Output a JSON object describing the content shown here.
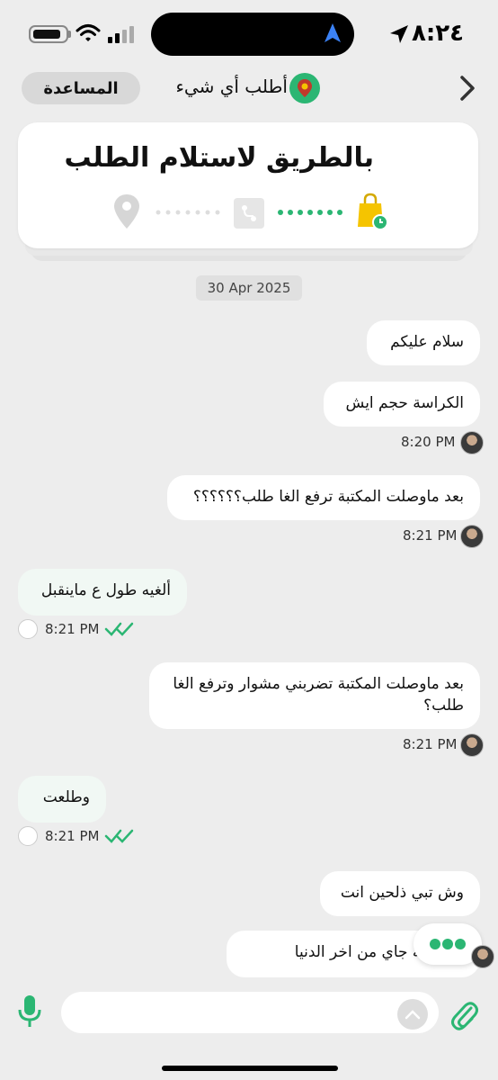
{
  "status_bar": {
    "time": "٨:٢٤"
  },
  "header": {
    "help_label": "المساعدة",
    "title": "أطلب أي شيء"
  },
  "order_card": {
    "title": "بالطريق لاستلام الطلب"
  },
  "date_chip": "30 Apr 2025",
  "messages": [
    {
      "text": "سلام عليكم"
    },
    {
      "text": "الكراسة حجم ايش",
      "time": "8:20 PM"
    },
    {
      "text": "بعد ماوصلت المكتبة ترفع الغا طلب؟؟؟؟؟؟",
      "time": "8:21 PM"
    },
    {
      "text": "ألغيه طول ع ماينقبل",
      "time": "8:21 PM"
    },
    {
      "text": "بعد ماوصلت المكتبة تضربني مشوار وترفع الغا طلب؟",
      "time": "8:21 PM"
    },
    {
      "text": "وطلعت",
      "time": "8:21 PM"
    },
    {
      "text": "وش تبي ذلحين انت"
    },
    {
      "text": "فالمكتبة جاي من اخر الدنيا"
    }
  ],
  "composer": {
    "placeholder": ""
  },
  "colors": {
    "accent": "#2bb673",
    "bag": "#f5c400",
    "background": "#ededed"
  },
  "icons": [
    "navigation-arrow-icon",
    "battery-icon",
    "wifi-icon",
    "signal-icon",
    "back-chevron-icon",
    "app-logo-icon",
    "shopping-bag-icon",
    "route-icon",
    "location-pin-icon",
    "mic-icon",
    "chevron-up-icon",
    "paperclip-icon",
    "double-check-icon"
  ]
}
